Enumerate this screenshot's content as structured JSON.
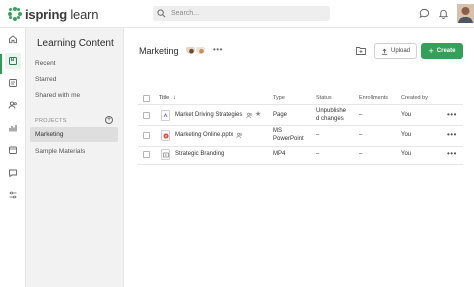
{
  "brand": {
    "logo_strong": "ispring",
    "logo_light": " learn",
    "accent": "#35a05a"
  },
  "search": {
    "placeholder": "Search..."
  },
  "rail": {
    "icons": [
      "home-icon",
      "library-icon",
      "courses-icon",
      "users-icon",
      "reports-icon",
      "calendar-icon",
      "messages-icon",
      "settings-icon"
    ],
    "active_index": 1
  },
  "library": {
    "title": "Learning Content",
    "links": [
      "Recent",
      "Starred",
      "Shared with me"
    ],
    "projects_label": "PROJECTS",
    "projects": [
      "Marketing",
      "Sample Materials"
    ],
    "selected_project": "Marketing"
  },
  "main": {
    "title": "Marketing",
    "upload_label": "Upload",
    "create_label": "Create",
    "create_plus": "+"
  },
  "table": {
    "columns": {
      "title": "Title",
      "type": "Type",
      "status": "Status",
      "enrollments": "Enrollments",
      "created_by": "Created by"
    },
    "rows": [
      {
        "title": "Market Driving Strategies",
        "type": "Page",
        "status_l1": "Unpublishe",
        "status_l2": "d changes",
        "enrollments": "–",
        "created_by": "You",
        "icon": "page-icon"
      },
      {
        "title": "Marketing Online.pptx",
        "type_l1": "MS",
        "type_l2": "PowerPoint",
        "status": "–",
        "enrollments": "–",
        "created_by": "You",
        "icon": "powerpoint-icon"
      },
      {
        "title": "Strategic Branding",
        "type": "MP4",
        "status": "–",
        "enrollments": "–",
        "created_by": "You",
        "icon": "video-icon"
      }
    ]
  }
}
